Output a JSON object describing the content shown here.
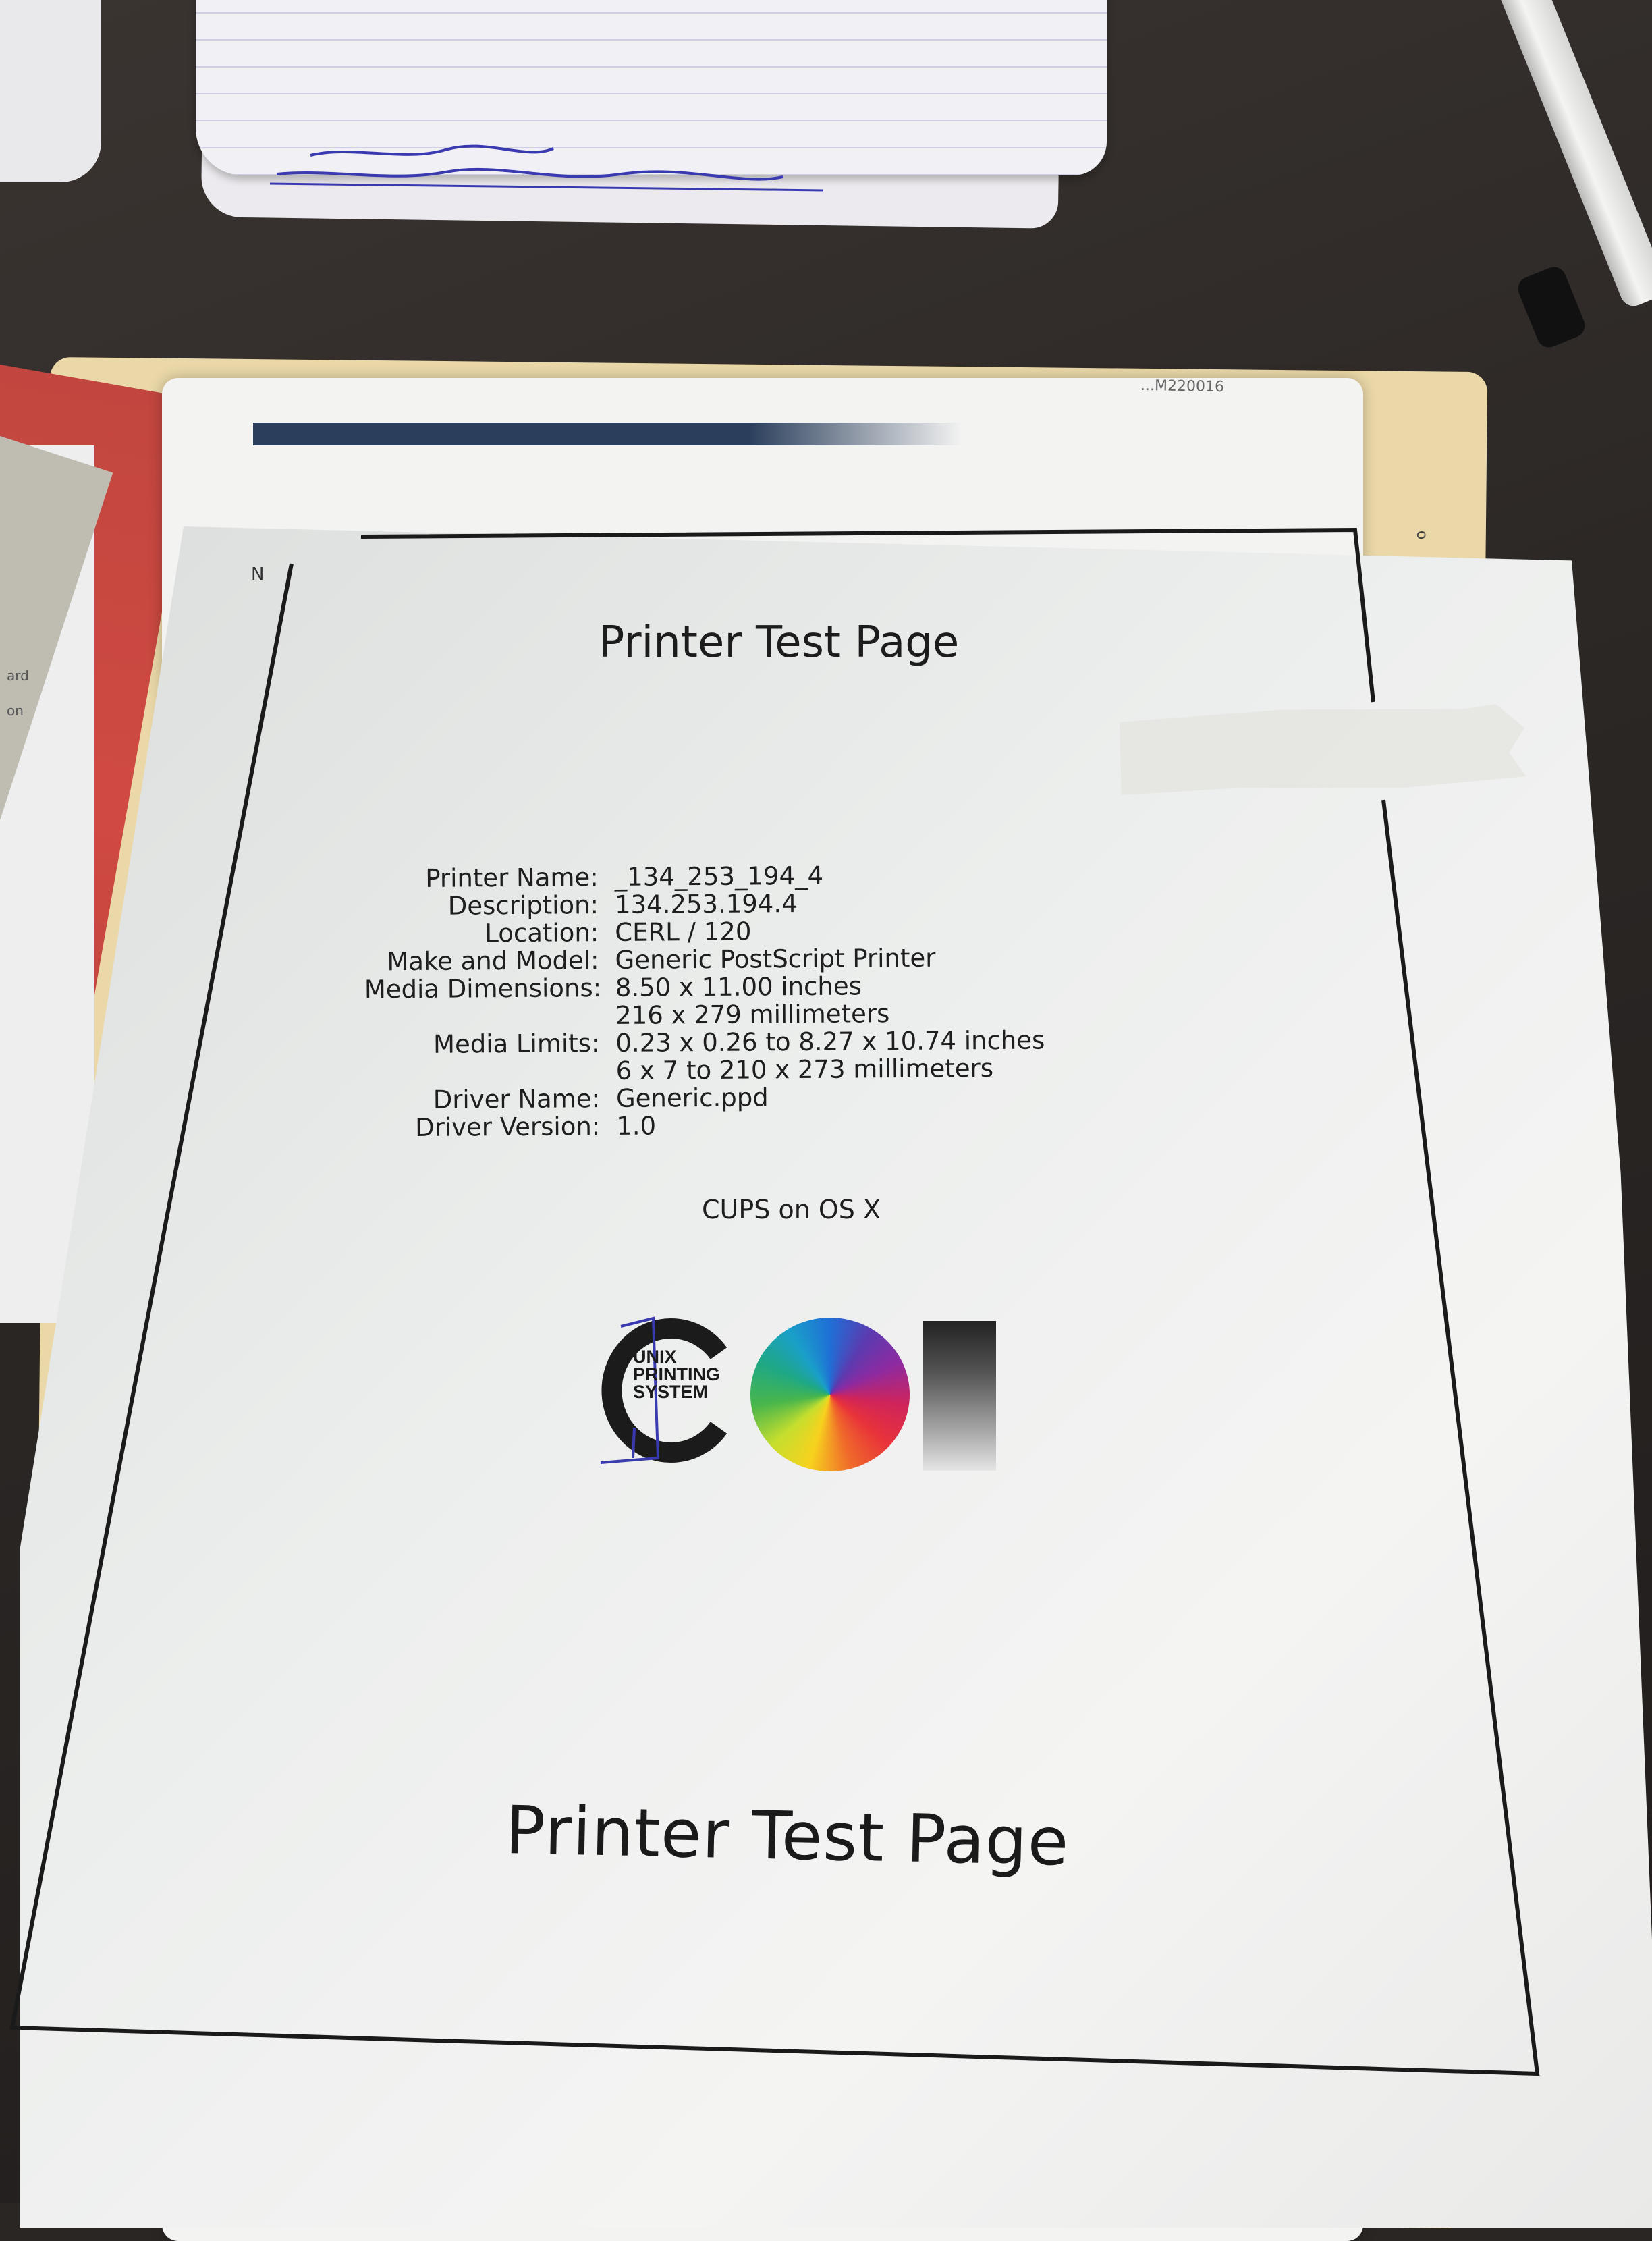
{
  "scene": {
    "folder_code": "...M220016",
    "corner_mark": "N",
    "side_mark": "o",
    "left_sheet_fragments": [
      "ard",
      "on"
    ]
  },
  "notepad": {
    "handwriting": "Sudin Mechab Fullwel Backups"
  },
  "test_page": {
    "title_top": "Printer Test Page",
    "fields": [
      {
        "label": "Printer Name:",
        "value": "_134_253_194_4"
      },
      {
        "label": "Description:",
        "value": "134.253.194.4"
      },
      {
        "label": "Location:",
        "value": "CERL / 120"
      },
      {
        "label": "Make and Model:",
        "value": "Generic PostScript Printer"
      },
      {
        "label": "Media Dimensions:",
        "value": "8.50 x 11.00 inches"
      },
      {
        "label": "",
        "value": "216 x 279 millimeters"
      },
      {
        "label": "Media Limits:",
        "value": "0.23 x 0.26 to 8.27 x 10.74 inches"
      },
      {
        "label": "",
        "value": "6 x 7 to 210 x 273 millimeters"
      },
      {
        "label": "Driver Name:",
        "value": "Generic.ppd"
      },
      {
        "label": "Driver Version:",
        "value": "1.0"
      }
    ],
    "cups_line": "CUPS on OS X",
    "logo_lines": [
      "UNIX",
      "PRINTING",
      "SYSTEM"
    ],
    "title_bottom": "Printer Test Page"
  },
  "colors": {
    "desk": "#2a2624",
    "paper": "#eeeeed",
    "folder": "#ead8a8",
    "frame": "#1a1a1a",
    "ink_blue": "#3a3ab0"
  }
}
